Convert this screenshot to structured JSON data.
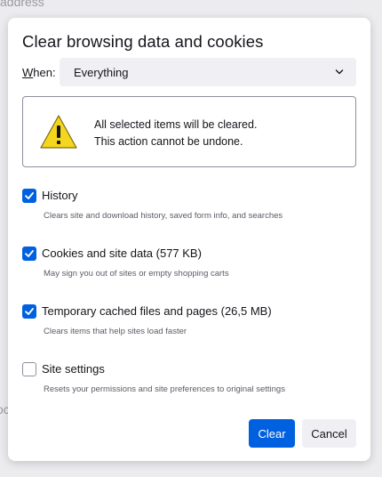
{
  "background": {
    "address_text": "address",
    "fragment_text": "oc"
  },
  "dialog": {
    "title": "Clear browsing data and cookies",
    "when": {
      "label": "When:",
      "label_accesskey": "W",
      "label_rest": "hen:",
      "selected": "Everything"
    },
    "warning": {
      "line1": "All selected items will be cleared.",
      "line2": "This action cannot be undone."
    },
    "options": [
      {
        "label": "History",
        "description": "Clears site and download history, saved form info, and searches",
        "checked": true
      },
      {
        "label": "Cookies and site data (577 KB)",
        "description": "May sign you out of sites or empty shopping carts",
        "checked": true
      },
      {
        "label": "Temporary cached files and pages (26,5 MB)",
        "description": "Clears items that help sites load faster",
        "checked": true
      },
      {
        "label": "Site settings",
        "description": "Resets your permissions and site preferences to original settings",
        "checked": false
      }
    ],
    "buttons": {
      "clear": "Clear",
      "cancel": "Cancel"
    }
  },
  "colors": {
    "accent": "#0061e0",
    "warning_yellow": "#f5d61f",
    "text": "#15141a",
    "muted_text": "#5b5b66"
  }
}
